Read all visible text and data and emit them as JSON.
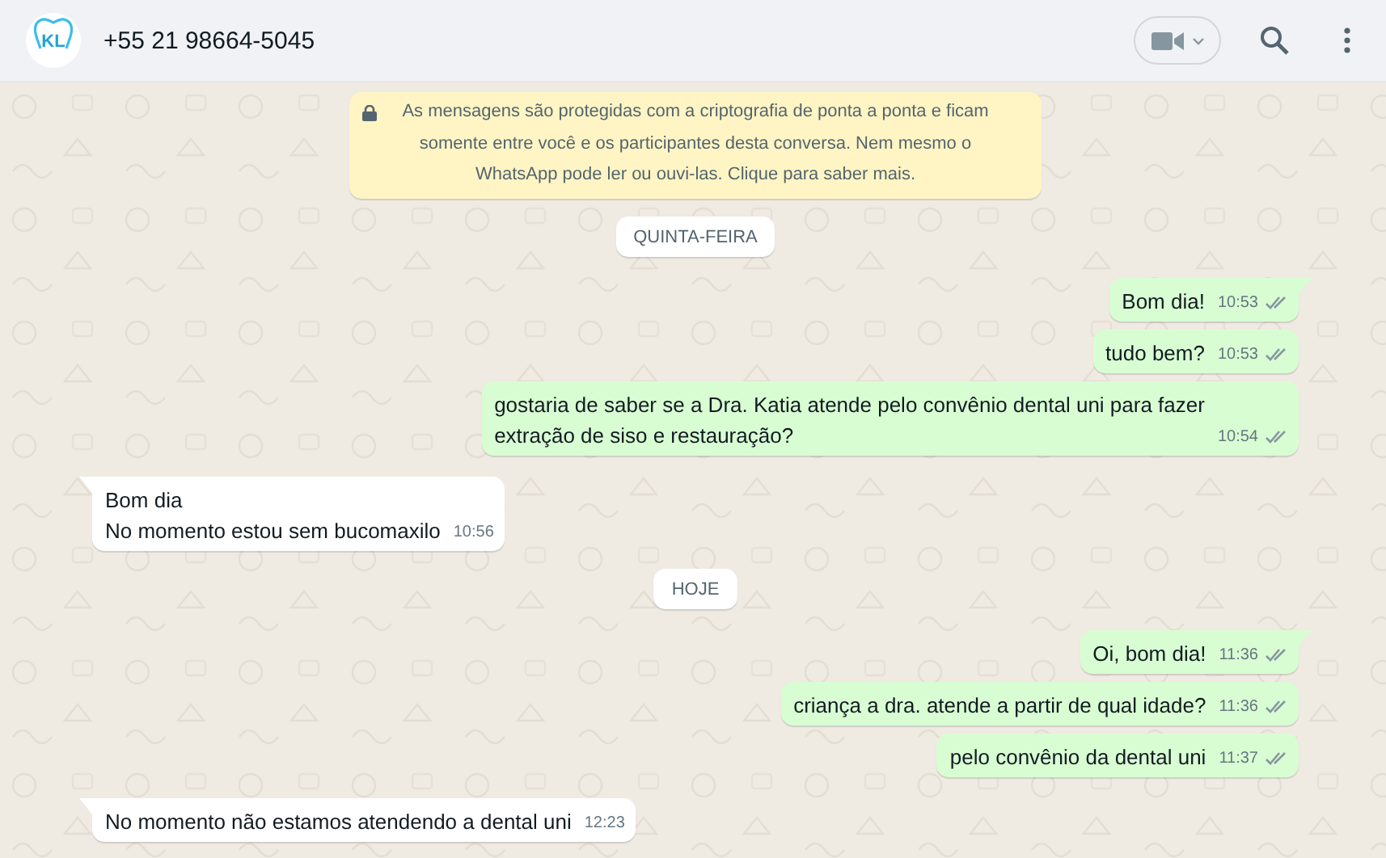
{
  "header": {
    "logo_text": "KL",
    "contact": "+55 21 98664-5045"
  },
  "notice": "As mensagens são protegidas com a criptografia de ponta a ponta e ficam somente entre você e os participantes desta conversa. Nem mesmo o WhatsApp pode ler ou ouvi-las. Clique para saber mais.",
  "items": [
    {
      "kind": "date",
      "text": "QUINTA-FEIRA"
    },
    {
      "kind": "out",
      "text": "Bom dia!",
      "time": "10:53",
      "read": false
    },
    {
      "kind": "out",
      "text": "tudo bem?",
      "time": "10:53",
      "read": false
    },
    {
      "kind": "out",
      "text": "gostaria de saber se a Dra. Katia atende pelo convênio dental uni para fazer\nextração de siso e restauração?",
      "time": "10:54",
      "read": false
    },
    {
      "kind": "in",
      "text": "Bom dia\nNo momento estou sem bucomaxilo",
      "time": "10:56"
    },
    {
      "kind": "date",
      "text": "HOJE"
    },
    {
      "kind": "out",
      "text": "Oi, bom dia!",
      "time": "11:36",
      "read": false
    },
    {
      "kind": "out",
      "text": "criança a dra. atende a partir de qual idade?",
      "time": "11:36",
      "read": false
    },
    {
      "kind": "out",
      "text": "pelo convênio da dental uni",
      "time": "11:37",
      "read": false
    },
    {
      "kind": "in",
      "text": "No momento não estamos atendendo a dental uni",
      "time": "12:23"
    }
  ]
}
